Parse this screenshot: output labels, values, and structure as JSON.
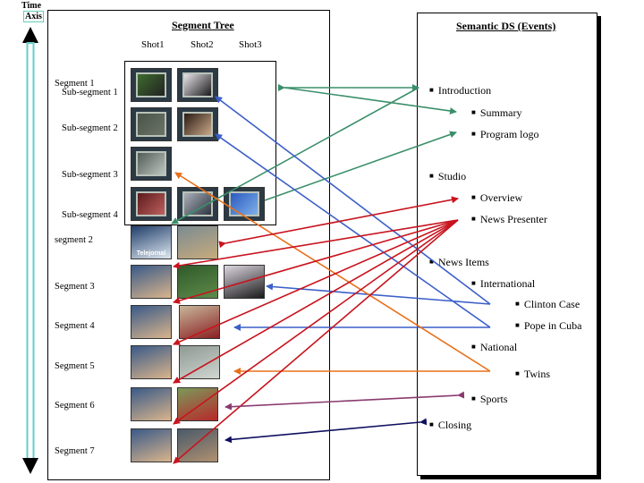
{
  "time_axis": {
    "line1": "Time",
    "line2": "Axis",
    "color": "#66cccc"
  },
  "segment_tree": {
    "title": "Segment Tree",
    "shot_headers": [
      "Shot1",
      "Shot2",
      "Shot3"
    ],
    "rows": [
      {
        "label": "Segment 1",
        "indent": false,
        "thumbs": []
      },
      {
        "label": "Sub-segment 1",
        "indent": true,
        "thumbs": [
          {
            "name": "outdoor-speaker",
            "colors": [
              "#3d6b2e",
              "#222"
            ]
          },
          {
            "name": "woman-portrait",
            "colors": [
              "#e8e4ea",
              "#1a1a1a"
            ]
          }
        ]
      },
      {
        "label": "Sub-segment 2",
        "indent": true,
        "thumbs": [
          {
            "name": "crowd",
            "colors": [
              "#4a5348",
              "#6b7466"
            ]
          },
          {
            "name": "woman-closeup",
            "colors": [
              "#2a1a12",
              "#c9a98a"
            ]
          }
        ]
      },
      {
        "label": "Sub-segment 3",
        "indent": true,
        "thumbs": [
          {
            "name": "studio-desk",
            "colors": [
              "#4f5c55",
              "#bfc5c0"
            ]
          }
        ]
      },
      {
        "label": "Sub-segment 4",
        "indent": true,
        "thumbs": [
          {
            "name": "red-logo",
            "colors": [
              "#5b1a1a",
              "#c06060"
            ]
          },
          {
            "name": "studio-people",
            "colors": [
              "#aab0b8",
              "#2e3540"
            ]
          },
          {
            "name": "blue-screen",
            "colors": [
              "#2a5ac0",
              "#7fb0e8"
            ]
          }
        ]
      },
      {
        "label": "segment 2",
        "indent": false,
        "thumbs": [
          {
            "name": "telejornal-logo",
            "colors": [
              "#1f3e6a",
              "#dfe8f0"
            ],
            "caption": "Telejornal"
          },
          {
            "name": "studio-set",
            "colors": [
              "#7b8b92",
              "#c7ab7c"
            ]
          }
        ]
      },
      {
        "label": "Segment 3",
        "indent": false,
        "thumbs": [
          {
            "name": "presenter",
            "colors": [
              "#3a5a88",
              "#d8b48c"
            ]
          },
          {
            "name": "greenery",
            "colors": [
              "#2f5a2a",
              "#5e8a4a"
            ]
          },
          {
            "name": "woman-portrait-2",
            "colors": [
              "#dcd6e0",
              "#1a1a1a"
            ]
          }
        ]
      },
      {
        "label": "Segment 4",
        "indent": false,
        "thumbs": [
          {
            "name": "presenter",
            "colors": [
              "#3a5a88",
              "#d8b48c"
            ]
          },
          {
            "name": "pope",
            "colors": [
              "#c7b79a",
              "#8a1f22"
            ]
          }
        ]
      },
      {
        "label": "Segment 5",
        "indent": false,
        "thumbs": [
          {
            "name": "presenter",
            "colors": [
              "#3a5a88",
              "#d8b48c"
            ]
          },
          {
            "name": "hospital-hall",
            "colors": [
              "#8f9a94",
              "#d0d5d0"
            ]
          }
        ]
      },
      {
        "label": "Segment 6",
        "indent": false,
        "thumbs": [
          {
            "name": "presenter",
            "colors": [
              "#3a5a88",
              "#d8b48c"
            ]
          },
          {
            "name": "football",
            "colors": [
              "#7a9a5a",
              "#b8282a"
            ]
          }
        ]
      },
      {
        "label": "Segment 7",
        "indent": false,
        "thumbs": [
          {
            "name": "presenter",
            "colors": [
              "#3a5a88",
              "#d8b48c"
            ]
          },
          {
            "name": "studio-set-2",
            "colors": [
              "#4a5a6a",
              "#b09070"
            ]
          }
        ]
      }
    ]
  },
  "semantic": {
    "title": "Semantic DS (Events)",
    "events": [
      {
        "id": "introduction",
        "label": "Introduction",
        "level": 0
      },
      {
        "id": "summary",
        "label": "Summary",
        "level": 1
      },
      {
        "id": "program-logo",
        "label": "Program logo",
        "level": 1
      },
      {
        "id": "studio",
        "label": "Studio",
        "level": 0
      },
      {
        "id": "overview",
        "label": "Overview",
        "level": 1
      },
      {
        "id": "news-presenter",
        "label": "News Presenter",
        "level": 1
      },
      {
        "id": "news-items",
        "label": "News  Items",
        "level": 0
      },
      {
        "id": "international",
        "label": "International",
        "level": 1
      },
      {
        "id": "clinton-case",
        "label": "Clinton Case",
        "level": 2
      },
      {
        "id": "pope-in-cuba",
        "label": "Pope in Cuba",
        "level": 2
      },
      {
        "id": "national",
        "label": "National",
        "level": 1
      },
      {
        "id": "twins",
        "label": "Twins",
        "level": 2
      },
      {
        "id": "sports",
        "label": "Sports",
        "level": 1
      },
      {
        "id": "closing",
        "label": "Closing",
        "level": 0
      }
    ]
  },
  "link_colors": {
    "green": "#3a8f6a",
    "blue": "#3c5fc8",
    "red": "#c8141e",
    "orange": "#e8701a",
    "purple": "#8a3a6e",
    "navy": "#101060"
  }
}
